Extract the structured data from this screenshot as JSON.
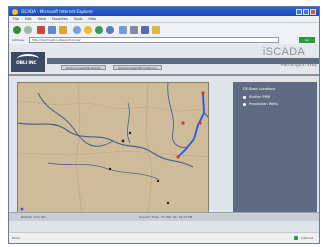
{
  "window": {
    "title": "iSCADA - Microsoft Internet Explorer"
  },
  "menu": [
    "File",
    "Edit",
    "View",
    "Favorites",
    "Tools",
    "Help"
  ],
  "address": {
    "label": "Address",
    "url": "http://farmington.sfasouth.local/",
    "go_label": "Go"
  },
  "header": {
    "brand": "iSCADA",
    "location": "Farmington Way",
    "logo_text": "OBLI INC",
    "tabs": [
      "Global Area/Dist Roster",
      "Global Area/Dist Positions"
    ]
  },
  "legend": {
    "title": "DE-Base Locations",
    "items": [
      "Station PRM",
      "Production Wells"
    ]
  },
  "footer": {
    "left": "Refresh 1:01 Pm",
    "center": "Current Time : Fri Mar 10, 12:15 PM"
  },
  "statusbar": {
    "text": "Done",
    "zone": "Internet"
  },
  "colors": {
    "titlebar": "#2f63d6",
    "map_land": "#cdbb9a",
    "river": "#4b5f8a",
    "highlight": "#2b56e0",
    "panel": "#5e6b82"
  }
}
